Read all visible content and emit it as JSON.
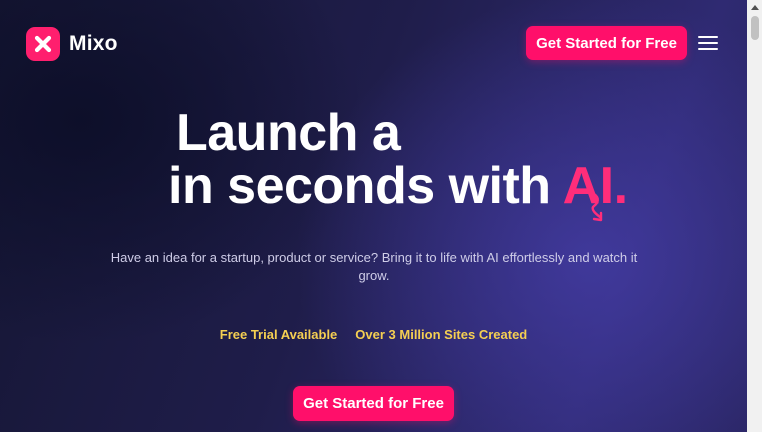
{
  "brand": {
    "name": "Mixo",
    "logo_icon": "x-mark-icon",
    "accent": "#ff0f6a"
  },
  "nav": {
    "cta_label": "Get Started for Free",
    "menu_icon": "hamburger-menu-icon"
  },
  "hero": {
    "line1": "Launch a",
    "line2_prefix": "in seconds with ",
    "line2_highlight": "AI.",
    "subtitle": "Have an idea for a startup, product or service? Bring it to life with AI effortlessly and watch it grow.",
    "badges": [
      "Free Trial Available",
      "Over 3 Million Sites Created"
    ],
    "cta_label": "Get Started for Free"
  }
}
